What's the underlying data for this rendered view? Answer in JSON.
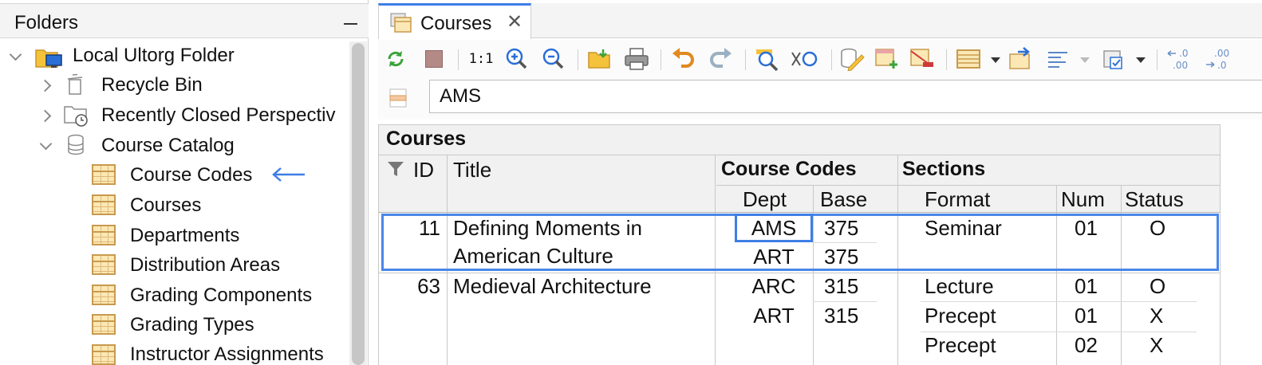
{
  "folders": {
    "title": "Folders",
    "root": {
      "label": "Local Ultorg Folder",
      "icon": "folder-monitor-icon"
    },
    "items": [
      {
        "label": "Recycle Bin",
        "icon": "trash-icon"
      },
      {
        "label": "Recently Closed Perspectiv",
        "icon": "recent-folder-icon"
      },
      {
        "label": "Course Catalog",
        "icon": "database-icon"
      }
    ],
    "tables": [
      {
        "label": "Course Codes",
        "icon": "table-icon"
      },
      {
        "label": "Courses",
        "icon": "table-icon"
      },
      {
        "label": "Departments",
        "icon": "table-icon"
      },
      {
        "label": "Distribution Areas",
        "icon": "table-icon"
      },
      {
        "label": "Grading Components",
        "icon": "table-icon"
      },
      {
        "label": "Grading Types",
        "icon": "table-icon"
      },
      {
        "label": "Instructor Assignments",
        "icon": "table-icon"
      }
    ],
    "pointer_icon": "left-arrow-icon"
  },
  "tab": {
    "label": "Courses",
    "close": "✕"
  },
  "toolbar": {
    "zoom_reset_label": "1:1",
    "decimal_less": ".0\n.00",
    "decimal_more": ".00\n.0"
  },
  "filter": {
    "value": "AMS"
  },
  "grid": {
    "title": "Courses",
    "headers": {
      "id": "ID",
      "title": "Title",
      "course_codes": "Course Codes",
      "dept": "Dept",
      "base": "Base",
      "sections": "Sections",
      "format": "Format",
      "num": "Num",
      "status": "Status"
    },
    "rows": [
      {
        "id": "11",
        "title_line1": "Defining Moments in",
        "title_line2": "American Culture",
        "codes": [
          {
            "dept": "AMS",
            "base": "375"
          },
          {
            "dept": "ART",
            "base": "375"
          }
        ],
        "sections": [
          {
            "format": "Seminar",
            "num": "01",
            "status": "O"
          }
        ]
      },
      {
        "id": "63",
        "title_line1": "Medieval Architecture",
        "codes": [
          {
            "dept": "ARC",
            "base": "315"
          },
          {
            "dept": "ART",
            "base": "315"
          }
        ],
        "sections": [
          {
            "format": "Lecture",
            "num": "01",
            "status": "O"
          },
          {
            "format": "Precept",
            "num": "01",
            "status": "X"
          },
          {
            "format": "Precept",
            "num": "02",
            "status": "X"
          }
        ]
      }
    ]
  },
  "colors": {
    "accent": "#3e7ee6",
    "table_icon": "#c89a4e",
    "header_bg": "#f1f1f1"
  }
}
